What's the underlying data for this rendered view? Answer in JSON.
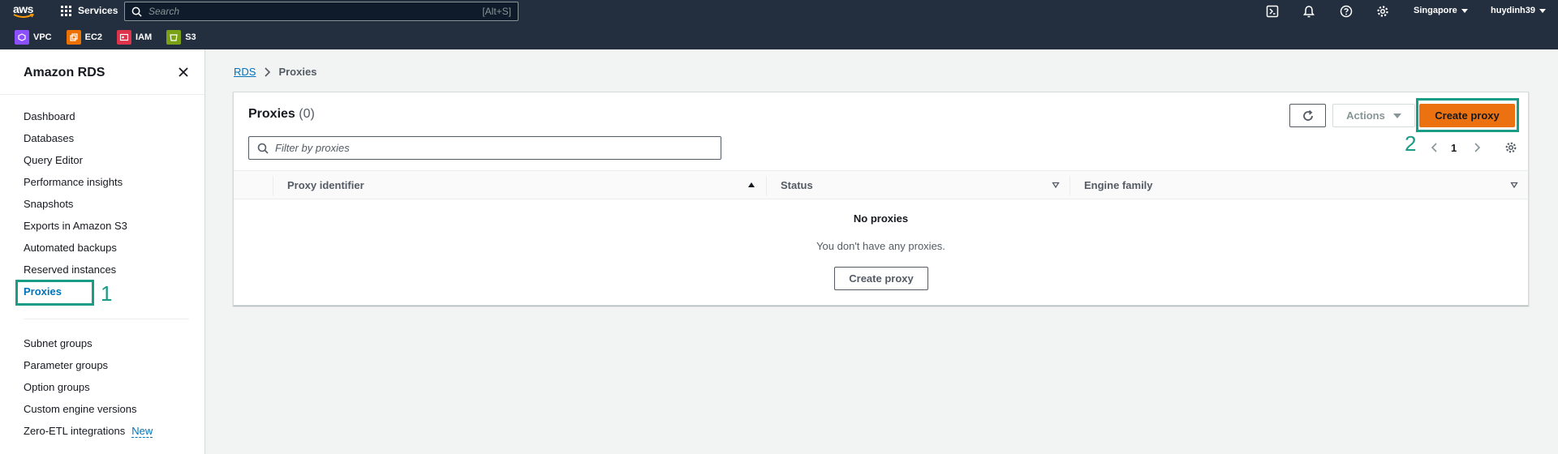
{
  "topnav": {
    "logo": "aws",
    "services_label": "Services",
    "search_placeholder": "Search",
    "search_shortcut": "[Alt+S]",
    "region": "Singapore",
    "user": "huydinh39",
    "favorites": [
      {
        "label": "VPC",
        "color": "#8c4fff",
        "icon": "vpc-icon"
      },
      {
        "label": "EC2",
        "color": "#ed7100",
        "icon": "ec2-icon"
      },
      {
        "label": "IAM",
        "color": "#dd344c",
        "icon": "iam-icon"
      },
      {
        "label": "S3",
        "color": "#7aa116",
        "icon": "s3-icon"
      }
    ]
  },
  "sidebar": {
    "title": "Amazon RDS",
    "items": [
      "Dashboard",
      "Databases",
      "Query Editor",
      "Performance insights",
      "Snapshots",
      "Exports in Amazon S3",
      "Automated backups",
      "Reserved instances",
      "Proxies"
    ],
    "items2": [
      "Subnet groups",
      "Parameter groups",
      "Option groups",
      "Custom engine versions",
      "Zero-ETL integrations"
    ],
    "new_badge": "New",
    "active": "Proxies"
  },
  "annotations": {
    "step1": "1",
    "step2": "2",
    "color": "#1a9c86"
  },
  "breadcrumb": {
    "root": "RDS",
    "current": "Proxies"
  },
  "panel": {
    "title": "Proxies",
    "count": "(0)",
    "actions_label": "Actions",
    "create_label": "Create proxy",
    "filter_placeholder": "Filter by proxies",
    "page": "1",
    "columns": [
      "Proxy identifier",
      "Status",
      "Engine family"
    ],
    "empty_title": "No proxies",
    "empty_desc": "You don't have any proxies.",
    "empty_button": "Create proxy"
  },
  "colors": {
    "accent": "#ec7211",
    "link": "#0073bb",
    "nav": "#232f3e"
  }
}
